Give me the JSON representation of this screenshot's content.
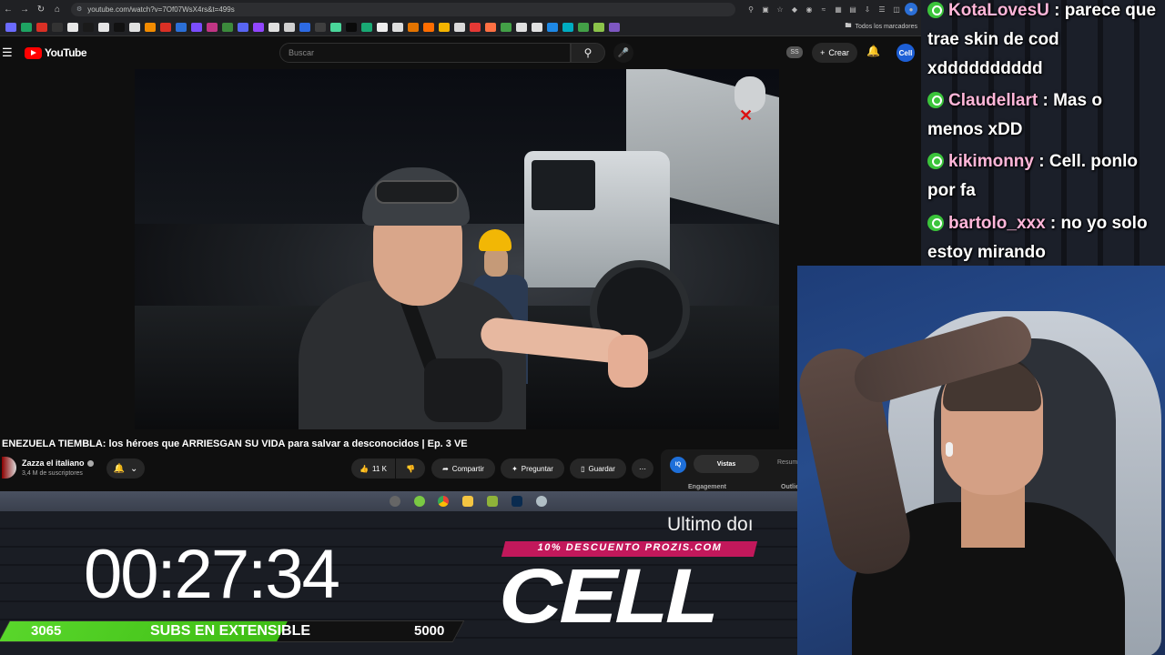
{
  "browser": {
    "url": "youtube.com/watch?v=7Of07WsX4rs&t=499s",
    "bookmarks_folder": "Todos los marcadores"
  },
  "youtube": {
    "logo_text": "YouTube",
    "search_placeholder": "Buscar",
    "ss_badge": "SS",
    "create_label": "Crear",
    "avatar_text": "Cell"
  },
  "video": {
    "title": "ENEZUELA TIEMBLA: los héroes que ARRIESGAN SU VIDA para salvar a desconocidos | Ep. 3 VE",
    "channel_name": "Zazza el italiano",
    "channel_subs": "3,4 M de suscriptores",
    "likes": "11 K",
    "share_label": "Compartir",
    "ask_label": "Preguntar",
    "save_label": "Guardar"
  },
  "side_panel": {
    "badge": "IQ",
    "tab_views": "Vistas",
    "tab_summary": "Resum",
    "engagement_label": "Engagement",
    "outlier_label": "Outlie"
  },
  "overlay": {
    "timer": "00:27:34",
    "sub_current": "3065",
    "sub_label": "SUBS EN EXTENSIBLE",
    "sub_goal": "5000",
    "sub_progress": 0.613,
    "ticker_text": "Ultimo doı",
    "promo_text": "10% DESCUENTO PROZIS.COM",
    "logo_text": "CELL"
  },
  "chat": {
    "messages": [
      {
        "user": "KotaLovesU",
        "text": "parece que trae skin de cod xdddddddddd"
      },
      {
        "user": "Claudellart",
        "text": "Mas o menos xDD"
      },
      {
        "user": "kikimonny",
        "text": "Cell. ponlo por fa"
      },
      {
        "user": "bartolo_xxx",
        "text": "no yo solo estoy mirando"
      }
    ],
    "username_color": "#ffb6d9",
    "badge_color": "#3bc43b"
  },
  "colors": {
    "yt_red": "#ff0000",
    "progress_green": "#59d62b",
    "promo_pink": "#c2185b"
  }
}
